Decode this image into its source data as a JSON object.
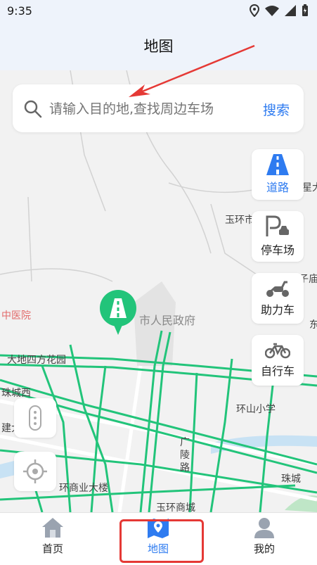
{
  "status_bar": {
    "time": "9:35"
  },
  "header": {
    "title": "地图"
  },
  "search": {
    "placeholder": "请输入目的地,查找周边车场",
    "button_label": "搜索"
  },
  "layers": [
    {
      "label": "道路",
      "icon": "road-icon",
      "active": true
    },
    {
      "label": "停车场",
      "icon": "parking-icon",
      "active": false
    },
    {
      "label": "助力车",
      "icon": "scooter-icon",
      "active": false
    },
    {
      "label": "自行车",
      "icon": "bicycle-icon",
      "active": false
    }
  ],
  "map_labels": {
    "poi_1": "玉环市",
    "poi_2": "中医院",
    "poi_3": "市人民政府",
    "poi_4": "大地四方花园",
    "poi_5": "环山小学",
    "poi_6": "环商业大楼",
    "poi_7": "玉环商城",
    "poi_8": "广陵路",
    "poi_9": "珠城",
    "poi_10": "珠城西",
    "poi_11": "星大",
    "poi_12": "子庙",
    "poi_13": "建大",
    "poi_14": "东"
  },
  "bottom_nav": [
    {
      "label": "首页",
      "icon": "home-icon",
      "active": false
    },
    {
      "label": "地图",
      "icon": "map-icon",
      "active": true
    },
    {
      "label": "我的",
      "icon": "profile-icon",
      "active": false
    }
  ],
  "colors": {
    "accent": "#2e7bf0",
    "road_green": "#22c47a",
    "annotation_red": "#e53935"
  }
}
